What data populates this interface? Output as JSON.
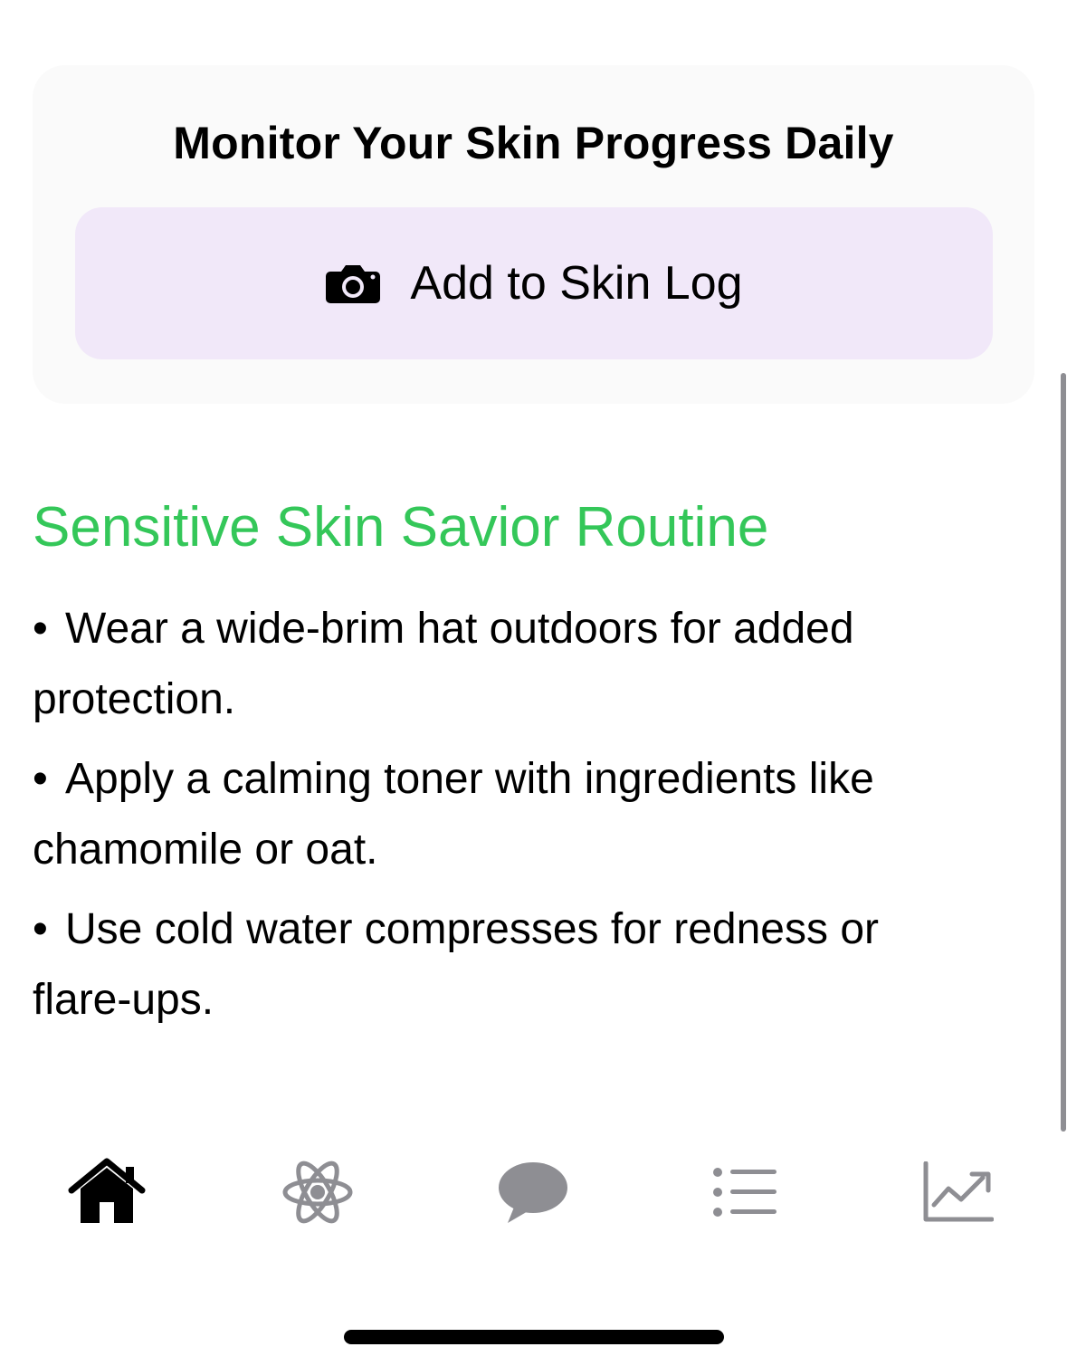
{
  "card": {
    "title": "Monitor Your Skin Progress Daily",
    "button_label": "Add to Skin Log",
    "button_icon": "camera-icon",
    "background_color": "#fafafa",
    "button_color": "#f1e8f9"
  },
  "routine": {
    "title": "Sensitive Skin Savior Routine",
    "title_color": "#34c759",
    "tips": [
      {
        "bullet": "•",
        "text": "Wear a wide-brim hat outdoors for added protection."
      },
      {
        "bullet": "•",
        "text": "Apply a calming toner with ingredients like chamomile or oat."
      },
      {
        "bullet": "•",
        "text": "Use cold water compresses for redness or flare-ups."
      }
    ]
  },
  "tabbar": {
    "tabs": [
      {
        "icon": "home-icon",
        "selected": true
      },
      {
        "icon": "atom-icon",
        "selected": false
      },
      {
        "icon": "chat-bubble-icon",
        "selected": false
      },
      {
        "icon": "list-icon",
        "selected": false
      },
      {
        "icon": "chart-trend-icon",
        "selected": false
      }
    ],
    "active_color": "#000000",
    "inactive_color": "#8e8e93"
  }
}
